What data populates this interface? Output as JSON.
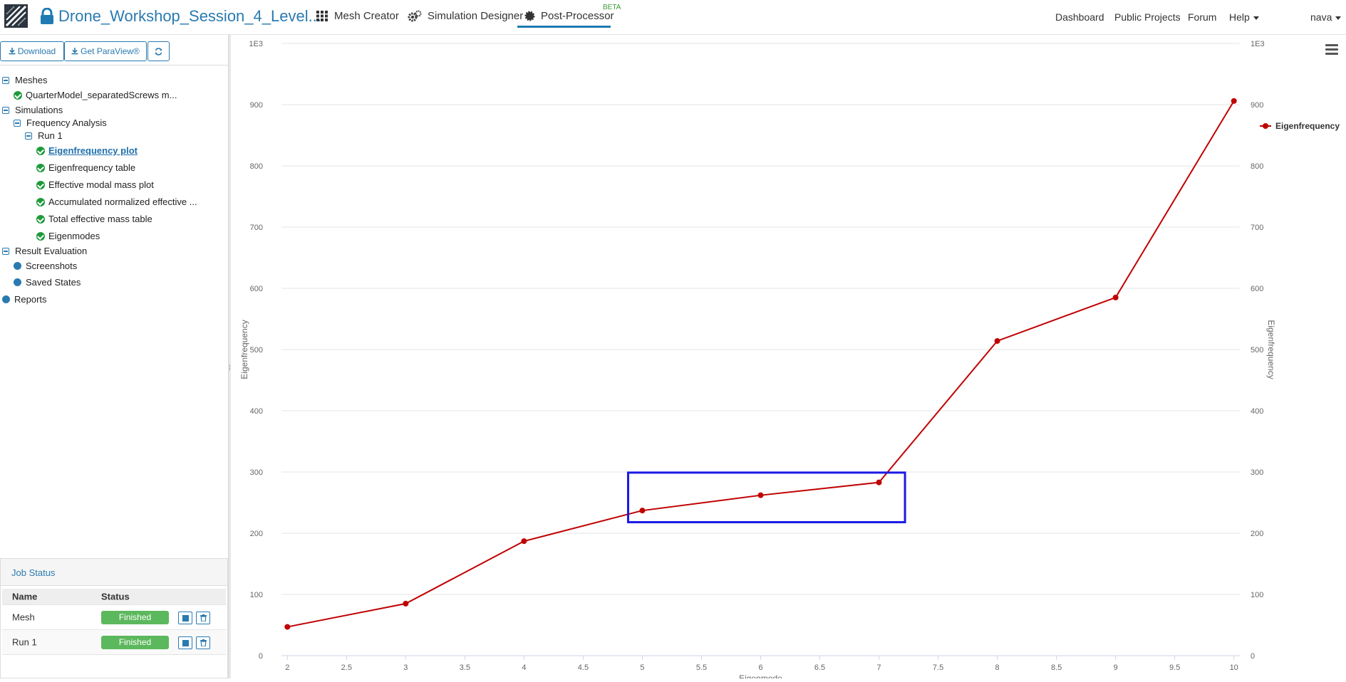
{
  "header": {
    "project_title": "Drone_Workshop_Session_4_Level...",
    "tabs": [
      {
        "label": "Mesh Creator",
        "icon": "grid-icon"
      },
      {
        "label": "Simulation Designer",
        "icon": "gears-icon"
      },
      {
        "label": "Post-Processor",
        "icon": "cog-icon",
        "active": true
      }
    ],
    "beta_badge": "BETA",
    "right_links": [
      "Dashboard",
      "Public Projects",
      "Forum",
      "Help"
    ],
    "user": "nava"
  },
  "toolbar": {
    "download_label": "Download",
    "paraview_label": "Get ParaView®"
  },
  "tree": {
    "meshes_label": "Meshes",
    "mesh_item": "QuarterModel_separatedScrews m...",
    "simulations_label": "Simulations",
    "analysis_label": "Frequency Analysis",
    "run_label": "Run 1",
    "run_items": [
      "Eigenfrequency plot",
      "Eigenfrequency table",
      "Effective modal mass plot",
      "Accumulated normalized effective ...",
      "Total effective mass table",
      "Eigenmodes"
    ],
    "result_eval_label": "Result Evaluation",
    "result_items": [
      "Screenshots",
      "Saved States"
    ],
    "reports_label": "Reports"
  },
  "job_status": {
    "title": "Job Status",
    "col_name": "Name",
    "col_status": "Status",
    "rows": [
      {
        "name": "Mesh",
        "status": "Finished"
      },
      {
        "name": "Run 1",
        "status": "Finished"
      }
    ]
  },
  "colors": {
    "accent": "#2a7ab0",
    "series": "#c00000",
    "highlight_box": "#1a1ae6",
    "success": "#5cb85c"
  },
  "chart_data": {
    "type": "line",
    "title": "",
    "xlabel": "Eigenmode",
    "ylabel": "Eigenfrequency",
    "y_unit_label": "1E3",
    "xlim": [
      1.95,
      10.05
    ],
    "ylim": [
      0,
      1000
    ],
    "x_ticks": [
      2,
      2.5,
      3,
      3.5,
      4,
      4.5,
      5,
      5.5,
      6,
      6.5,
      7,
      7.5,
      8,
      8.5,
      9,
      9.5,
      10
    ],
    "y_ticks": [
      0,
      100,
      200,
      300,
      400,
      500,
      600,
      700,
      800,
      900
    ],
    "grid": true,
    "legend_position": "top-right",
    "series": [
      {
        "name": "Eigenfrequency",
        "x": [
          2,
          3,
          4,
          5,
          6,
          7,
          8,
          9,
          10
        ],
        "values": [
          47,
          85,
          187,
          237,
          262,
          283,
          514,
          585,
          906
        ]
      }
    ],
    "annotation": {
      "type": "rectangle",
      "x_range": [
        4.88,
        7.22
      ],
      "y_range": [
        218,
        299
      ]
    }
  }
}
